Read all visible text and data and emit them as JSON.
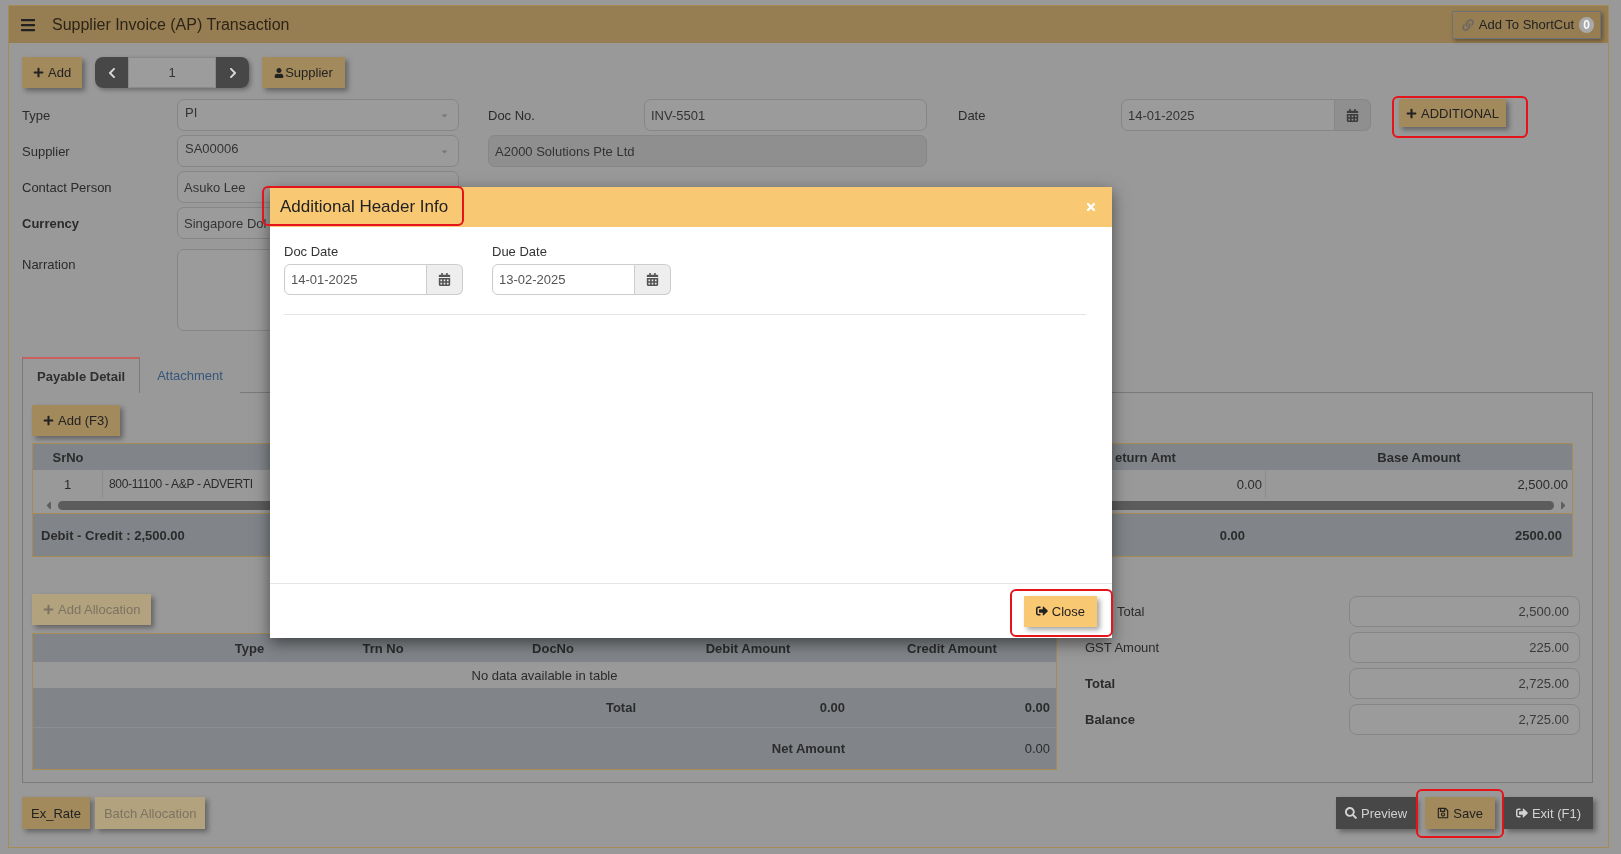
{
  "header": {
    "title": "Supplier Invoice (AP) Transaction",
    "shortcut": {
      "label": "Add To ShortCut",
      "count": "0"
    }
  },
  "toolbar": {
    "add_label": "Add",
    "record": "1",
    "supplier_label": "Supplier"
  },
  "form": {
    "type": {
      "label": "Type",
      "value": "PI"
    },
    "doc_no": {
      "label": "Doc No.",
      "value": "INV-5501"
    },
    "date": {
      "label": "Date",
      "value": "14-01-2025"
    },
    "additional": {
      "label": "ADDITIONAL",
      "highlighted": true
    },
    "supplier": {
      "label": "Supplier",
      "value": "SA00006",
      "name": "A2000 Solutions Pte Ltd"
    },
    "contact_person": {
      "label": "Contact Person",
      "value": "Asuko Lee"
    },
    "currency": {
      "label": "Currency",
      "value": "Singapore Dol"
    },
    "narration": {
      "label": "Narration"
    }
  },
  "tabs": [
    {
      "label": "Payable Detail",
      "selected": true
    },
    {
      "label": "Attachment",
      "selected": false
    }
  ],
  "detail": {
    "add_label": "Add (F3)",
    "columns": [
      "SrNo",
      "eturn Amt",
      "Base Amount"
    ],
    "rows": [
      {
        "srno": "1",
        "column_2": "800-11100 - A&P - ADVERTI",
        "column_3": "0.00",
        "base_amount": "2,500.00"
      }
    ],
    "footer": {
      "summary": "Debit - Credit : 2,500.00",
      "column_3": "0.00",
      "base_amount": "2500.00"
    }
  },
  "allocation": {
    "add_button": {
      "label": "Add Allocation",
      "disabled": true
    },
    "columns": [
      "Type",
      "Trn No",
      "DocNo",
      "Debit Amount",
      "Credit Amount"
    ],
    "empty_text": "No data available in table",
    "total": {
      "label": "Total",
      "debit": "0.00",
      "credit": "0.00"
    },
    "net_amount": {
      "label": "Net Amount",
      "value": "0.00"
    }
  },
  "summary": [
    {
      "label": "Total",
      "value": "2,500.00",
      "bold": false
    },
    {
      "label": "GST Amount",
      "value": "225.00",
      "bold": false
    },
    {
      "label": "Total",
      "value": "2,725.00",
      "bold": true
    },
    {
      "label": "Balance",
      "value": "2,725.00",
      "bold": true
    }
  ],
  "footer_buttons": {
    "left": [
      {
        "label": "Ex_Rate",
        "disabled": false
      },
      {
        "label": "Batch Allocation",
        "disabled": true
      }
    ],
    "right": [
      {
        "kind": "preview",
        "label": "Preview",
        "highlighted": false
      },
      {
        "kind": "save",
        "label": "Save",
        "highlighted": true
      },
      {
        "kind": "exit",
        "label": "Exit (F1)",
        "highlighted": false
      }
    ]
  },
  "modal": {
    "title": "Additional Header Info",
    "title_highlighted": true,
    "fields": [
      {
        "label": "Doc Date",
        "value": "14-01-2025"
      },
      {
        "label": "Due Date",
        "value": "13-02-2025"
      }
    ],
    "close_button": {
      "label": "Close",
      "highlighted": true
    }
  }
}
